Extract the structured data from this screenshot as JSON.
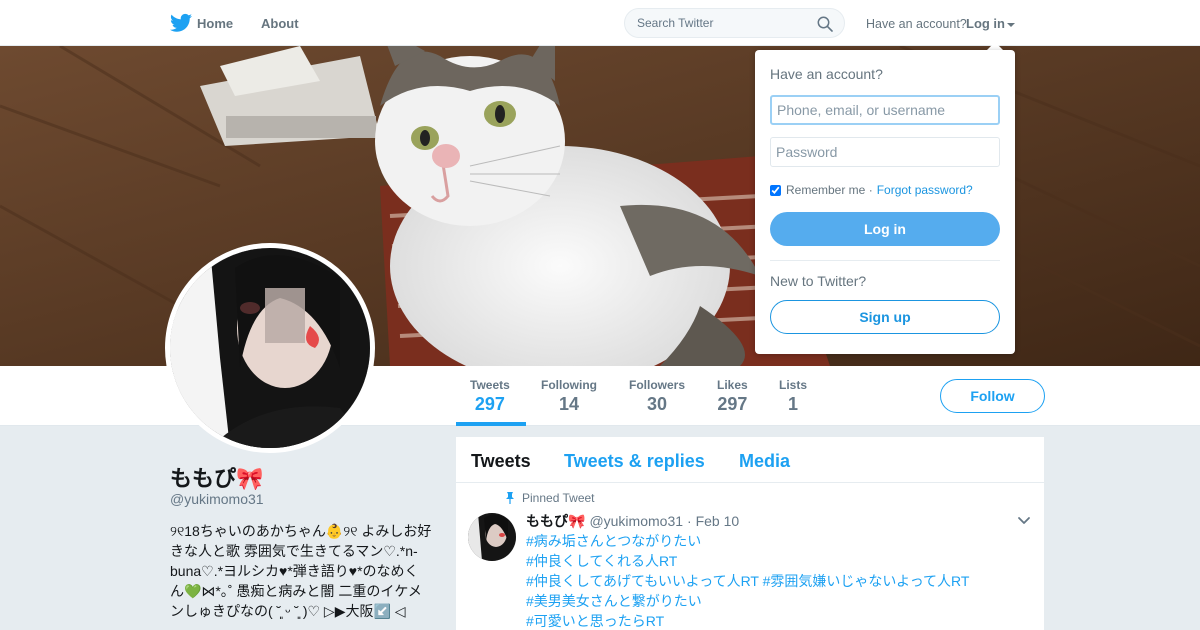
{
  "nav": {
    "home_label": "Home",
    "about_label": "About",
    "search_placeholder": "Search Twitter",
    "account_prompt": "Have an account?",
    "login_label": "Log in"
  },
  "profile": {
    "display_name": "ももぴ🎀",
    "screen_name": "@yukimomo31",
    "bio": "୨୧18ちゃいのあかちゃん👶୨୧ よみしお好きな人と歌 雰囲気で生きてるマン♡.*n-buna♡.*ヨルシカ♥*弾き語り♥*のなめくん💚⋈*｡˚ 愚痴と病みと闇 二重のイケメンしゅきぴなの( ˘͈ ᵕ ˘͈ )♡ ▷▶大阪↙️ ◁",
    "follow_label": "Follow"
  },
  "stats": [
    {
      "label": "Tweets",
      "value": "297",
      "active": true
    },
    {
      "label": "Following",
      "value": "14"
    },
    {
      "label": "Followers",
      "value": "30"
    },
    {
      "label": "Likes",
      "value": "297"
    },
    {
      "label": "Lists",
      "value": "1"
    }
  ],
  "timeline": {
    "tabs": [
      "Tweets",
      "Tweets & replies",
      "Media"
    ],
    "pinned_label": "Pinned Tweet",
    "tweet": {
      "name": "ももぴ🎀",
      "screen_name": "@yukimomo31",
      "date": "· Feb 10",
      "lines": [
        "#病み垢さんとつながりたい",
        "#仲良くしてくれる人RT",
        "#仲良くしてあげてもいいよって人RT #雰囲気嫌いじゃないよって人RT",
        "#美男美女さんと繋がりたい",
        "#可愛いと思ったらRT"
      ]
    }
  },
  "login_dropdown": {
    "title": "Have an account?",
    "username_placeholder": "Phone, email, or username",
    "password_placeholder": "Password",
    "remember_label": "Remember me ·",
    "forgot_label": "Forgot password?",
    "login_button": "Log in",
    "new_prompt": "New to Twitter?",
    "signup_button": "Sign up"
  },
  "colors": {
    "accent": "#1da1f2",
    "login_button": "#55acee",
    "background": "#e6ecf0"
  }
}
